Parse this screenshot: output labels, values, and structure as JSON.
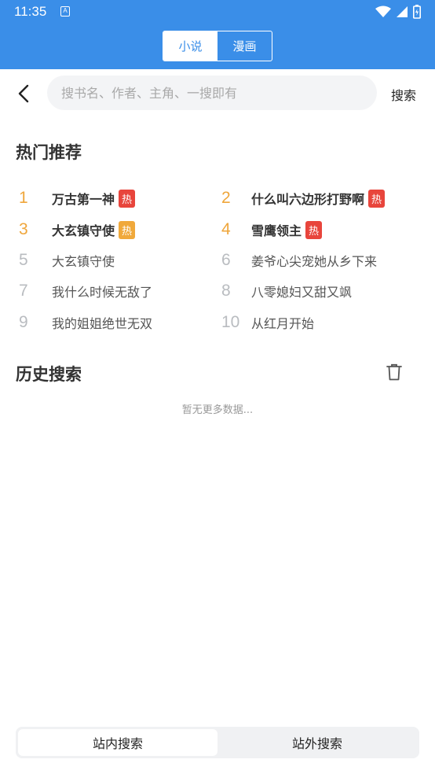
{
  "status": {
    "time": "11:35",
    "notif_letter": "A"
  },
  "tabs": [
    {
      "label": "小说",
      "active": true
    },
    {
      "label": "漫画",
      "active": false
    }
  ],
  "search": {
    "placeholder": "搜书名、作者、主角、一搜即有",
    "button_label": "搜索"
  },
  "hot": {
    "title": "热门推荐",
    "items": [
      {
        "rank": "1",
        "title": "万古第一神",
        "badge": "热",
        "badge_color": "#e8453c"
      },
      {
        "rank": "2",
        "title": "什么叫六边形打野啊",
        "badge": "热",
        "badge_color": "#e8453c"
      },
      {
        "rank": "3",
        "title": "大玄镇守使",
        "badge": "热",
        "badge_color": "#f0a93b"
      },
      {
        "rank": "4",
        "title": "雪鹰领主",
        "badge": "热",
        "badge_color": "#e8453c"
      },
      {
        "rank": "5",
        "title": "大玄镇守使"
      },
      {
        "rank": "6",
        "title": "姜爷心尖宠她从乡下来"
      },
      {
        "rank": "7",
        "title": "我什么时候无敌了"
      },
      {
        "rank": "8",
        "title": "八零媳妇又甜又飒"
      },
      {
        "rank": "9",
        "title": "我的姐姐绝世无双"
      },
      {
        "rank": "10",
        "title": "从红月开始"
      }
    ]
  },
  "history": {
    "title": "历史搜索",
    "empty_text": "暂无更多数据..."
  },
  "bottom_tabs": [
    {
      "label": "站内搜索",
      "active": true
    },
    {
      "label": "站外搜索",
      "active": false
    }
  ],
  "colors": {
    "brand": "#3a8ee8",
    "rank_top": "#efa63b",
    "rank_normal": "#b9bcc0",
    "badge_red": "#e8453c",
    "badge_orange": "#f0a93b"
  }
}
